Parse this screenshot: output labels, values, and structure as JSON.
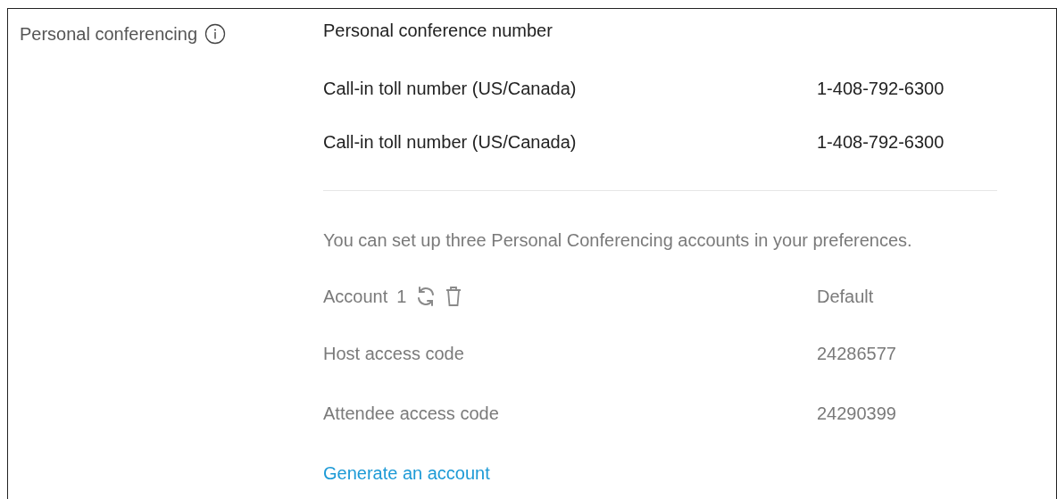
{
  "section": {
    "label": "Personal conferencing"
  },
  "heading": "Personal conference number",
  "numbers": [
    {
      "label": "Call-in toll number (US/Canada)",
      "value": "1-408-792-6300"
    },
    {
      "label": "Call-in toll number (US/Canada)",
      "value": "1-408-792-6300"
    }
  ],
  "note": "You can set up three Personal Conferencing accounts in your preferences.",
  "account": {
    "label": "Account",
    "number": "1",
    "status": "Default"
  },
  "codes": [
    {
      "label": "Host access code",
      "value": "24286577"
    },
    {
      "label": "Attendee access code",
      "value": "24290399"
    }
  ],
  "link": "Generate an account"
}
